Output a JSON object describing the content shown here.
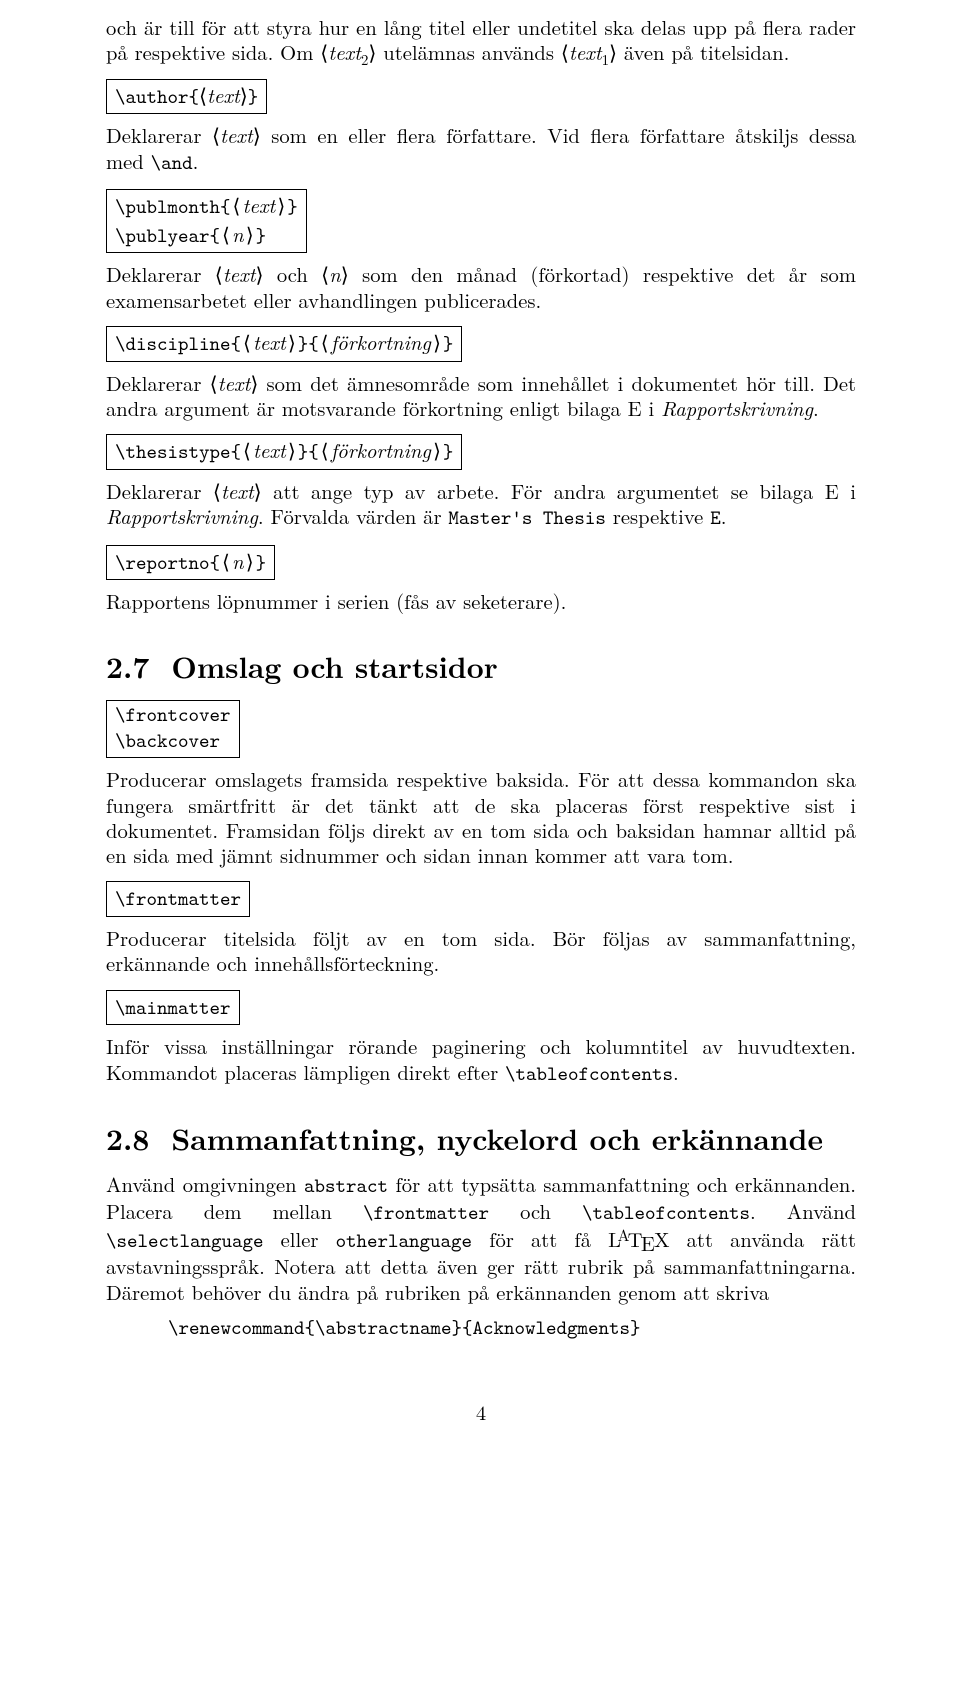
{
  "intro_para": {
    "part1": "och är till för att styra hur en lång titel eller undetitel ska delas upp på flera rader på respektive sida. Om ⟨",
    "text2": "text",
    "sub2": "2",
    "part2": "⟩ utelämnas används ⟨",
    "text1": "text",
    "sub1": "1",
    "part3": "⟩ även på titelsidan."
  },
  "author_box": "\\author{⟨text⟩}",
  "author_box_text": "text",
  "author_para": {
    "p1": "Deklarerar ⟨",
    "it1": "text",
    "p2": "⟩ som en eller flera författare. Vid flera författare åtskiljs dessa med ",
    "code": "\\and",
    "p3": "."
  },
  "publ_box": {
    "l1a": "\\publmonth{⟨",
    "l1it": "text",
    "l1b": "⟩}",
    "l2a": "\\publyear{⟨",
    "l2it": "n",
    "l2b": "⟩}"
  },
  "publ_para": {
    "p1": "Deklarerar ⟨",
    "it1": "text",
    "p2": "⟩ och ⟨",
    "it2": "n",
    "p3": "⟩ som den månad (förkortad) respektive det år som examensarbetet eller avhandlingen publicerades."
  },
  "disc_box": {
    "a": "\\discipline{⟨",
    "it1": "text",
    "b": "⟩}{⟨",
    "it2": "förkortning",
    "c": "⟩}"
  },
  "disc_para": {
    "p1": "Deklarerar ⟨",
    "it1": "text",
    "p2": "⟩ som det ämnesområde som innehållet i dokumentet hör till. Det andra argument är motsvarande förkortning enligt bilaga E i ",
    "it2": "Rapportskrivning",
    "p3": "."
  },
  "thesis_box": {
    "a": "\\thesistype{⟨",
    "it1": "text",
    "b": "⟩}{⟨",
    "it2": "förkortning",
    "c": "⟩}"
  },
  "thesis_para": {
    "p1": "Deklarerar ⟨",
    "it1": "text",
    "p2": "⟩ att ange typ av arbete. För andra argumentet se bilaga E i ",
    "it2": "Rapportskrivning",
    "p3": ". Förvalda värden är ",
    "code1": "Master's Thesis",
    "p4": " respektive ",
    "code2": "E",
    "p5": "."
  },
  "reportno_box": {
    "a": "\\reportno{⟨",
    "it": "n",
    "b": "⟩}"
  },
  "reportno_para": "Rapportens löpnummer i serien (fås av seketerare).",
  "sec27": {
    "num": "2.7",
    "title": "Omslag och startsidor"
  },
  "cover_box": {
    "l1": "\\frontcover",
    "l2": "\\backcover"
  },
  "cover_para": "Producerar omslagets framsida respektive baksida. För att dessa kommandon ska fungera smärtfritt är det tänkt att de ska placeras först respektive sist i dokumentet. Framsidan följs direkt av en tom sida och baksidan hamnar alltid på en sida med jämnt sidnummer och sidan innan kommer att vara tom.",
  "frontmatter_box": "\\frontmatter",
  "frontmatter_para": "Producerar titelsida följt av en tom sida. Bör följas av sammanfattning, erkännande och innehållsförteckning.",
  "mainmatter_box": "\\mainmatter",
  "mainmatter_para": {
    "p1": "Inför vissa inställningar rörande paginering och kolumntitel av huvudtexten. Kommandot placeras lämpligen direkt efter ",
    "code": "\\tableofcontents",
    "p2": "."
  },
  "sec28": {
    "num": "2.8",
    "title": "Sammanfattning, nyckelord och erkännande"
  },
  "sec28_para": {
    "p1": "Använd omgivningen ",
    "c1": "abstract",
    "p2": " för att typsätta sammanfattning och erkännanden. Placera dem mellan ",
    "c2": "\\frontmatter",
    "p3": " och ",
    "c3": "\\tableofcontents",
    "p4": ". Använd ",
    "c4": "\\selectlanguage",
    "p5": " eller ",
    "c5": "otherlanguage",
    "p6": " för att få ",
    "p7": " att använda rätt avstavningsspråk. Notera att detta även ger rätt rubrik på sammanfattningarna. Däremot behöver du ändra på rubriken på erkännanden genom att skriva"
  },
  "renew_code": "\\renewcommand{\\abstractname}{Acknowledgments}",
  "pagenum": "4"
}
